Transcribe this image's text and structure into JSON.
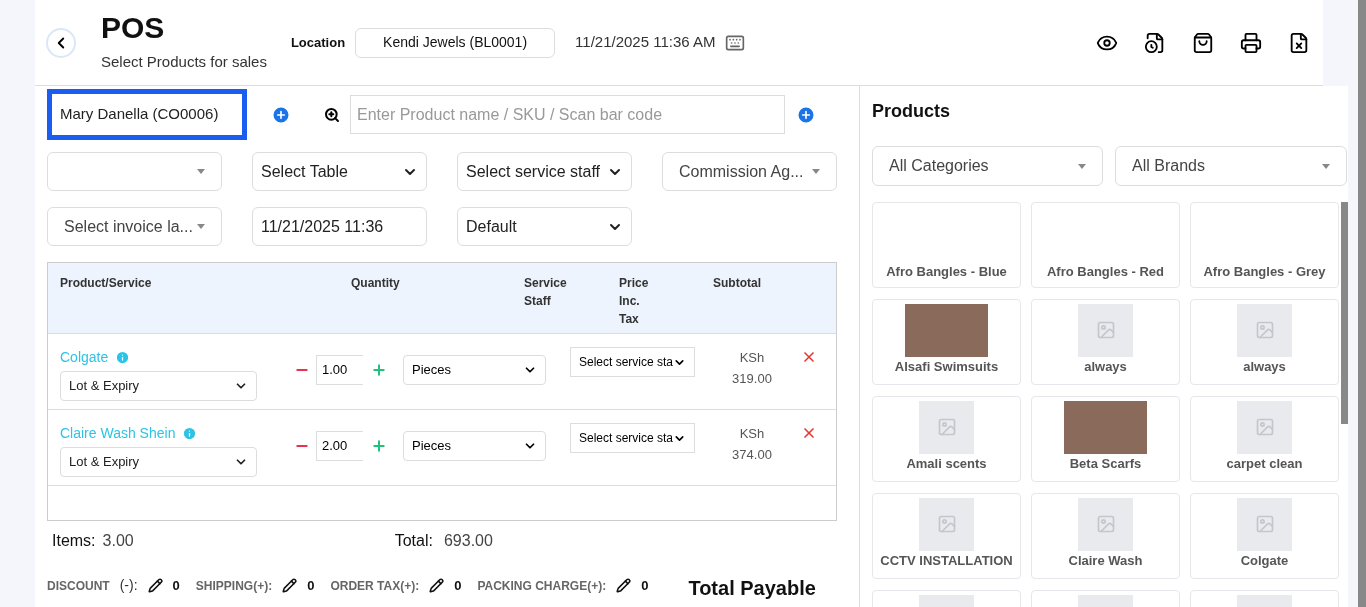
{
  "header": {
    "title": "POS",
    "subtitle": "Select Products for sales",
    "location_label": "Location",
    "location_value": "Kendi Jewels (BL0001)",
    "datetime": "11/21/2025 11:36 AM"
  },
  "customer": {
    "value": "Mary Danella (CO0006)",
    "focused": true
  },
  "search": {
    "placeholder": "Enter Product name / SKU / Scan bar code"
  },
  "filters_row_1": [
    {
      "kind": "select2"
    },
    {
      "kind": "native",
      "value": "Select Table"
    },
    {
      "kind": "native",
      "value": "Select service staff"
    },
    {
      "kind": "select2",
      "value": "Commission Ag..."
    }
  ],
  "filters_row_2": [
    {
      "kind": "select2",
      "value": "Select invoice la..."
    },
    {
      "kind": "input",
      "value": "11/21/2025 11:36"
    },
    {
      "kind": "native",
      "value": "Default"
    }
  ],
  "table": {
    "columns": [
      "Product/Service",
      "Quantity",
      "Service Staff",
      "Price Inc. Tax",
      "Subtotal"
    ],
    "rows": [
      {
        "name": "Colgate",
        "lot": "Lot & Expiry",
        "quantity": "1.00",
        "unit": "Pieces",
        "staff": "Select service sta",
        "currency": "KSh",
        "subtotal": "319.00"
      },
      {
        "name": "Claire Wash Shein",
        "lot": "Lot & Expiry",
        "quantity": "2.00",
        "unit": "Pieces",
        "staff": "Select service sta",
        "currency": "KSh",
        "subtotal": "374.00"
      }
    ]
  },
  "totals": {
    "items_label": "Items:",
    "items": "3.00",
    "total_label": "Total:",
    "total": "693.00"
  },
  "charges": [
    {
      "label": "DISCOUNT",
      "sign": "(-):",
      "value": "0"
    },
    {
      "label": "SHIPPING(+):",
      "value": "0"
    },
    {
      "label": "ORDER TAX(+):",
      "value": "0"
    },
    {
      "label": "PACKING CHARGE(+):",
      "value": "0"
    }
  ],
  "total_payable": "Total Payable",
  "products": {
    "title": "Products",
    "category": "All Categories",
    "brand": "All Brands",
    "items": [
      {
        "name": "Afro Bangles - Blue",
        "kind": "none"
      },
      {
        "name": "Afro Bangles - Red",
        "kind": "none"
      },
      {
        "name": "Afro Bangles - Grey",
        "kind": "none"
      },
      {
        "name": "Alsafi Swimsuits",
        "kind": "photo"
      },
      {
        "name": "always",
        "kind": "placeholder"
      },
      {
        "name": "always",
        "kind": "placeholder"
      },
      {
        "name": "Amali scents",
        "kind": "placeholder"
      },
      {
        "name": "Beta Scarfs",
        "kind": "photo"
      },
      {
        "name": "carpet clean",
        "kind": "placeholder"
      },
      {
        "name": "CCTV INSTALLATION",
        "kind": "placeholder"
      },
      {
        "name": "Claire Wash",
        "kind": "placeholder"
      },
      {
        "name": "Colgate",
        "kind": "placeholder"
      }
    ]
  }
}
